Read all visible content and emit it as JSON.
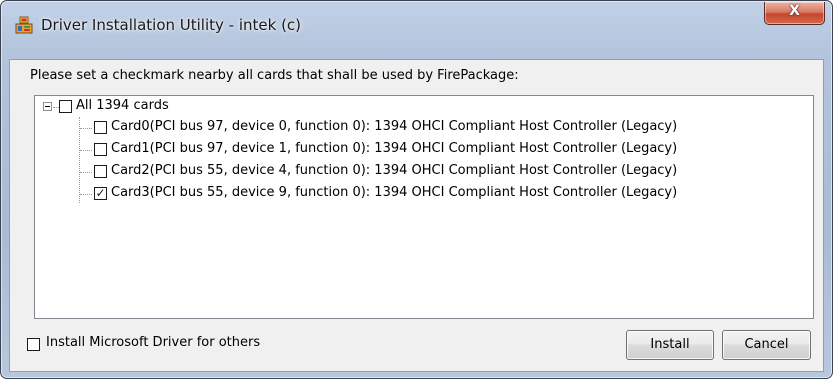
{
  "window": {
    "title": "Driver Installation Utility - intek (c)",
    "close_icon": "close-icon"
  },
  "instructions": "Please set a checkmark nearby all cards that shall be used by FirePackage:",
  "tree": {
    "root": {
      "label": "All 1394 cards",
      "checked": false,
      "expanded": true
    },
    "items": [
      {
        "label": "Card0(PCI bus 97, device 0, function 0): 1394 OHCI Compliant Host Controller (Legacy)",
        "checked": false
      },
      {
        "label": "Card1(PCI bus 97, device 1, function 0): 1394 OHCI Compliant Host Controller (Legacy)",
        "checked": false
      },
      {
        "label": "Card2(PCI bus 55, device 4, function 0): 1394 OHCI Compliant Host Controller (Legacy)",
        "checked": false
      },
      {
        "label": "Card3(PCI bus 55, device 9, function 0): 1394 OHCI Compliant Host Controller (Legacy)",
        "checked": true
      }
    ]
  },
  "options": {
    "ms_driver_label": "Install Microsoft Driver for others",
    "ms_driver_checked": false
  },
  "buttons": {
    "install_label": "Install",
    "cancel_label": "Cancel"
  },
  "colors": {
    "close_button": "#c4472c",
    "title_bar": "#b3c4dc",
    "client_bg": "#f0f0f0"
  }
}
